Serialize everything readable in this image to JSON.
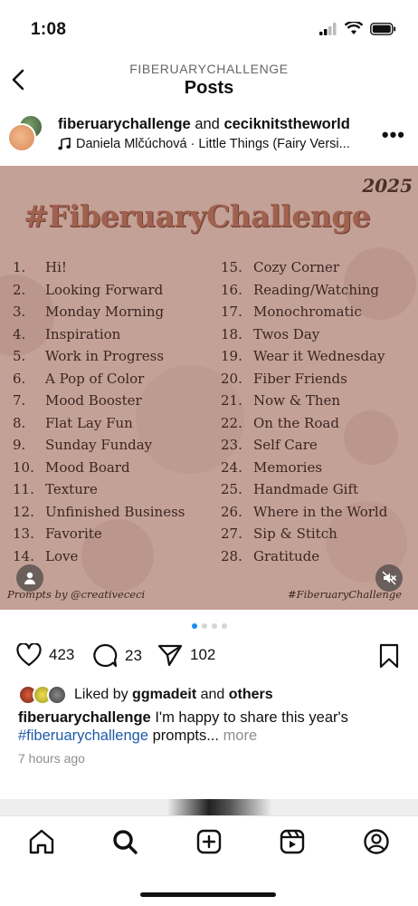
{
  "status": {
    "time": "1:08"
  },
  "nav": {
    "subtitle": "FIBERUARYCHALLENGE",
    "title": "Posts"
  },
  "post": {
    "author": "fiberuarychallenge",
    "coauthor_connector": "and",
    "coauthor": "ceciknitstheworld",
    "audio": "Daniela Mlčúchová · Little Things (Fairy Versi..."
  },
  "image": {
    "year": "2025",
    "title": "#FiberuaryChallenge",
    "prompts_left": [
      {
        "num": "1.",
        "text": "Hi!"
      },
      {
        "num": "2.",
        "text": "Looking Forward"
      },
      {
        "num": "3.",
        "text": "Monday Morning"
      },
      {
        "num": "4.",
        "text": "Inspiration"
      },
      {
        "num": "5.",
        "text": "Work in Progress"
      },
      {
        "num": "6.",
        "text": "A Pop of Color"
      },
      {
        "num": "7.",
        "text": "Mood Booster"
      },
      {
        "num": "8.",
        "text": "Flat Lay Fun"
      },
      {
        "num": "9.",
        "text": "Sunday Funday"
      },
      {
        "num": "10.",
        "text": "Mood Board"
      },
      {
        "num": "11.",
        "text": "Texture"
      },
      {
        "num": "12.",
        "text": "Unfinished Business"
      },
      {
        "num": "13.",
        "text": "Favorite"
      },
      {
        "num": "14.",
        "text": "Love"
      }
    ],
    "prompts_right": [
      {
        "num": "15.",
        "text": "Cozy Corner"
      },
      {
        "num": "16.",
        "text": "Reading/Watching"
      },
      {
        "num": "17.",
        "text": "Monochromatic"
      },
      {
        "num": "18.",
        "text": "Twos Day"
      },
      {
        "num": "19.",
        "text": "Wear it Wednesday"
      },
      {
        "num": "20.",
        "text": "Fiber Friends"
      },
      {
        "num": "21.",
        "text": "Now & Then"
      },
      {
        "num": "22.",
        "text": "On the Road"
      },
      {
        "num": "23.",
        "text": "Self Care"
      },
      {
        "num": "24.",
        "text": "Memories"
      },
      {
        "num": "25.",
        "text": "Handmade Gift"
      },
      {
        "num": "26.",
        "text": "Where in the World"
      },
      {
        "num": "27.",
        "text": "Sip & Stitch"
      },
      {
        "num": "28.",
        "text": "Gratitude"
      }
    ],
    "credit_left": "Prompts by @creativececi",
    "credit_right": "#FiberuaryChallenge"
  },
  "carousel": {
    "total": 4,
    "active": 1
  },
  "actions": {
    "likes": "423",
    "comments": "23",
    "shares": "102"
  },
  "liked_by": {
    "prefix": "Liked by",
    "user": "ggmadeit",
    "connector": "and",
    "others": "others"
  },
  "caption": {
    "user": "fiberuarychallenge",
    "text_before": "I'm happy to share this year's",
    "hashtag": "#fiberuarychallenge",
    "text_after": "prompts...",
    "more": "more"
  },
  "time_ago": "7 hours ago",
  "colors": {
    "link": "#1f5aa8",
    "accent_dot": "#1a8cf0",
    "image_bg": "#c4a197"
  },
  "tabs": [
    "home-icon",
    "search-icon",
    "create-icon",
    "reels-icon",
    "profile-icon"
  ]
}
